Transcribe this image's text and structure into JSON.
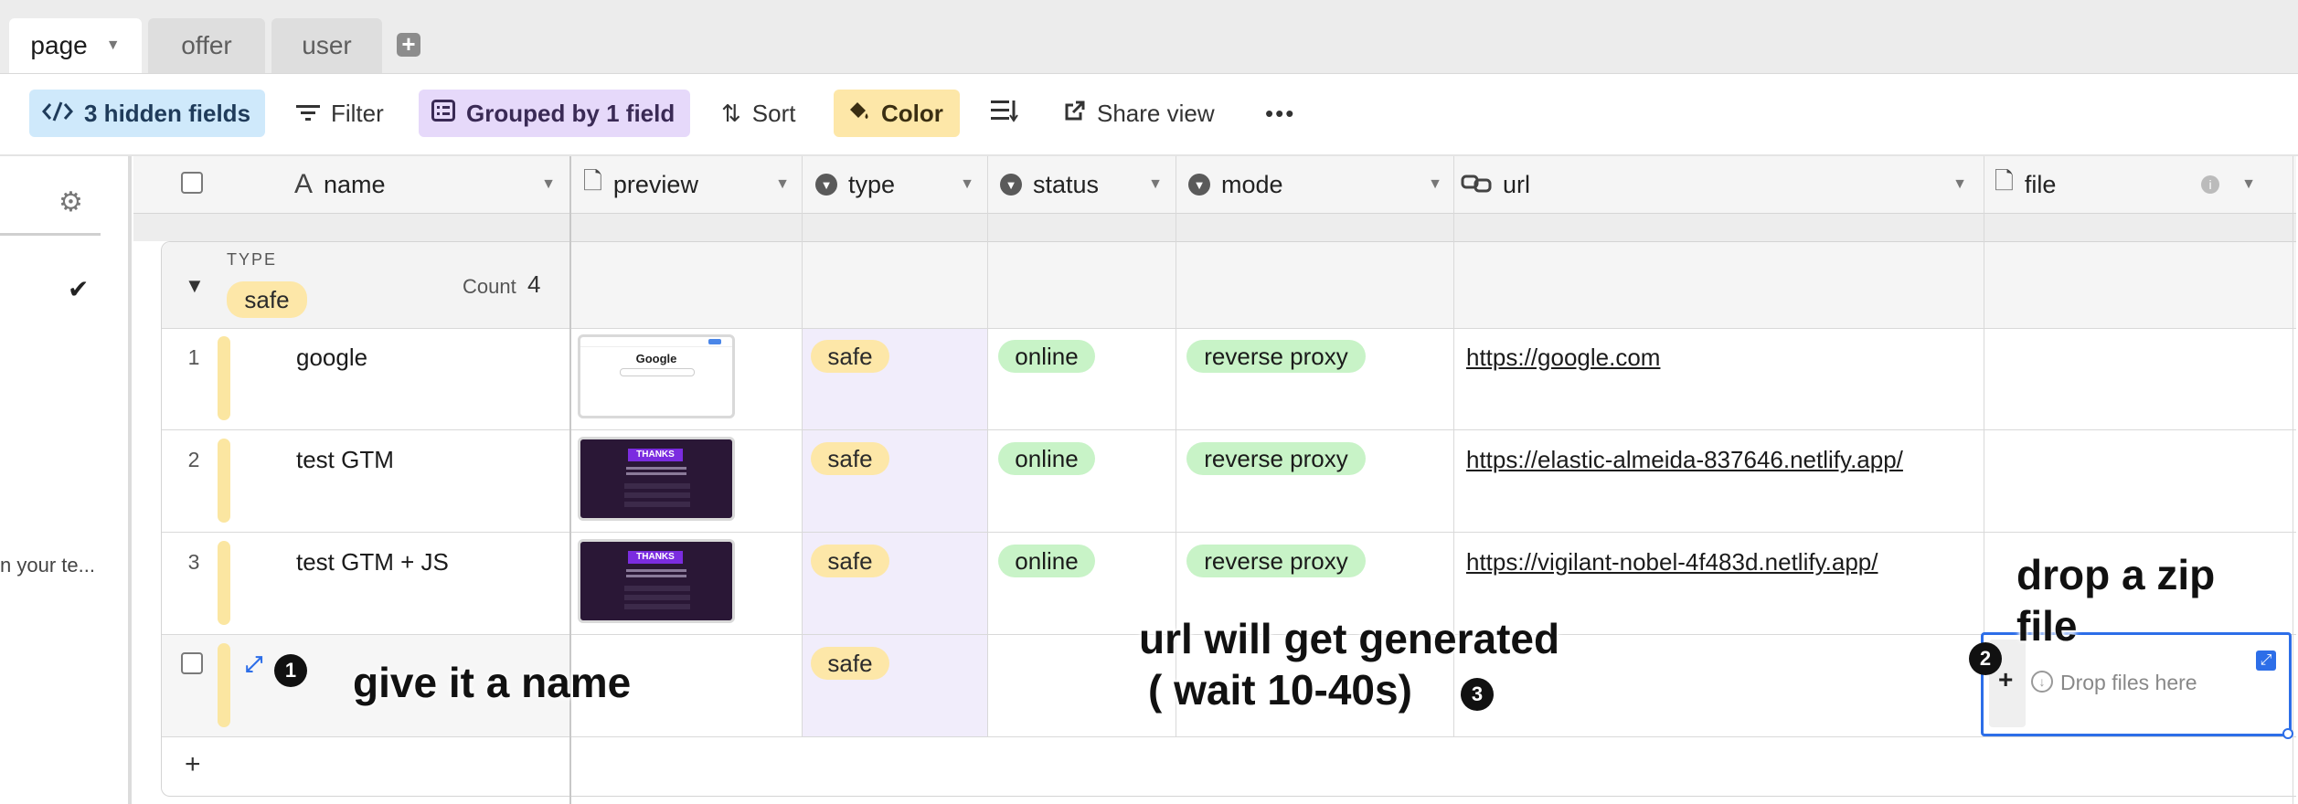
{
  "tabs": [
    {
      "label": "page",
      "active": true
    },
    {
      "label": "offer",
      "active": false
    },
    {
      "label": "user",
      "active": false
    }
  ],
  "toolbar": {
    "hidden_fields": "3 hidden fields",
    "filter": "Filter",
    "grouped": "Grouped by 1 field",
    "sort": "Sort",
    "color": "Color",
    "share_view": "Share view",
    "more": "•••"
  },
  "colors": {
    "hidden_fields_bg": "#cfe9fb",
    "grouped_bg": "#e6d9fa",
    "color_bg": "#fde7a8",
    "safe_pill": "#fde7a8",
    "online_pill": "#c8f3c7",
    "focus_border": "#2d6ee8"
  },
  "sidebar": {
    "truncated_text": "n your te..."
  },
  "columns": [
    {
      "label": "name",
      "icon": "text-field-icon"
    },
    {
      "label": "preview",
      "icon": "document-icon"
    },
    {
      "label": "type",
      "icon": "single-select-icon"
    },
    {
      "label": "status",
      "icon": "single-select-icon"
    },
    {
      "label": "mode",
      "icon": "single-select-icon"
    },
    {
      "label": "url",
      "icon": "link-icon"
    },
    {
      "label": "file",
      "icon": "document-icon"
    }
  ],
  "group": {
    "field_label": "TYPE",
    "value": "safe",
    "count_label": "Count",
    "count": "4"
  },
  "rows": [
    {
      "num": "1",
      "name": "google",
      "type": "safe",
      "status": "online",
      "mode": "reverse proxy",
      "url": "https://google.com",
      "preview": "google"
    },
    {
      "num": "2",
      "name": "test GTM",
      "type": "safe",
      "status": "online",
      "mode": "reverse proxy",
      "url": "https://elastic-almeida-837646.netlify.app/",
      "preview": "dark"
    },
    {
      "num": "3",
      "name": "test GTM + JS",
      "type": "safe",
      "status": "online",
      "mode": "reverse proxy",
      "url": "https://vigilant-nobel-4f483d.netlify.app/",
      "preview": "dark"
    }
  ],
  "new_row": {
    "type": "safe",
    "drop_files": "Drop files here"
  },
  "thumb_text": {
    "google_logo": "Google",
    "thanks": "THANKS"
  },
  "annotations": {
    "name": "give it a name",
    "url_line1": "url will get generated",
    "url_line2": "( wait 10-40s)",
    "file_line1": "drop a zip",
    "file_line2": "file",
    "badge1": "1",
    "badge2": "2",
    "badge3": "3"
  }
}
